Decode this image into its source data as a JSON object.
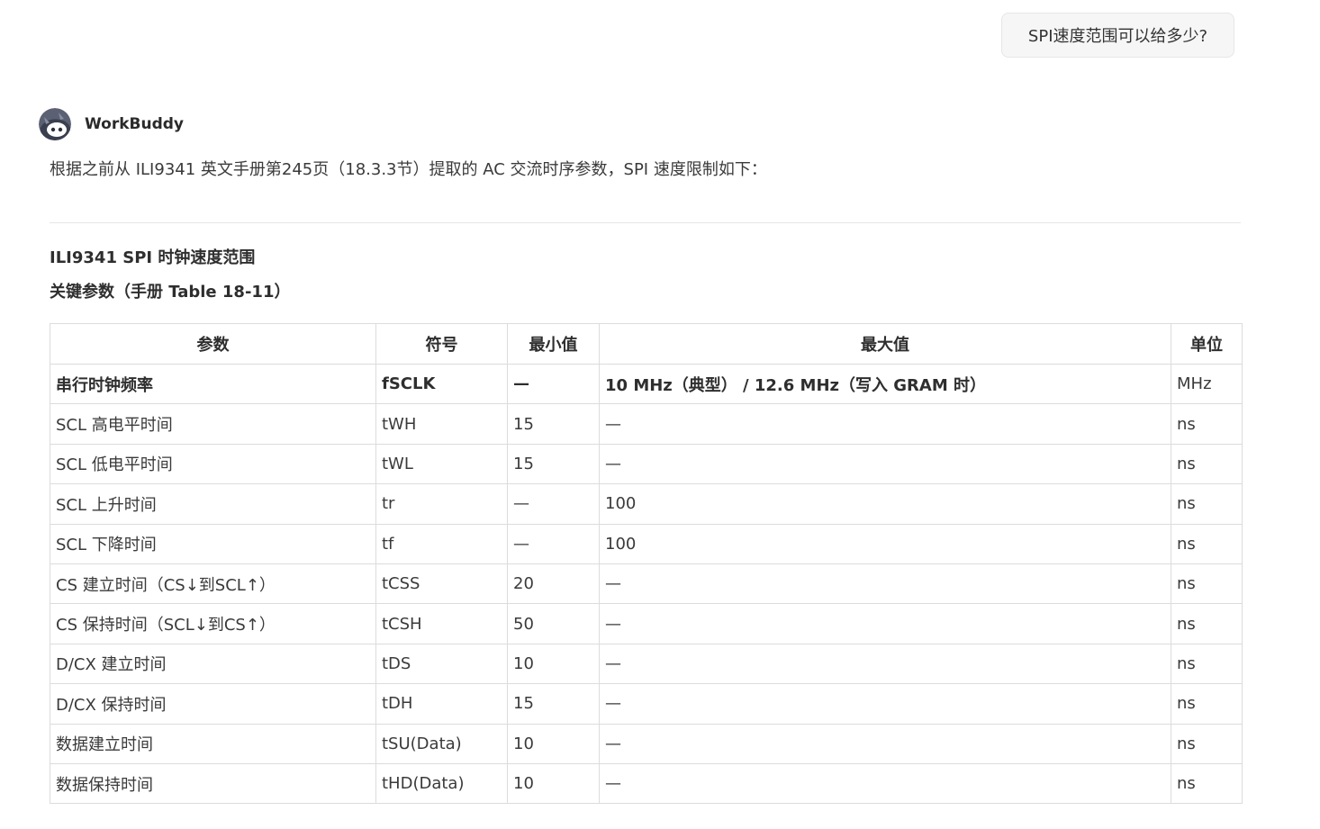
{
  "user_message": {
    "text": "SPI速度范围可以给多少?"
  },
  "assistant": {
    "name": "WorkBuddy",
    "avatar_icon": "robot-avatar-icon",
    "intro": "根据之前从 ILI9341 英文手册第245页（18.3.3节）提取的 AC 交流时序参数，SPI 速度限制如下："
  },
  "section": {
    "title": "ILI9341 SPI 时钟速度范围",
    "subtitle": "关键参数（手册 Table 18-11）"
  },
  "table": {
    "headers": [
      "参数",
      "符号",
      "最小值",
      "最大值",
      "单位"
    ],
    "rows": [
      [
        "串行时钟频率",
        "fSCLK",
        "—",
        "10 MHz（典型） / 12.6 MHz（写入 GRAM 时）",
        "MHz"
      ],
      [
        "SCL 高电平时间",
        "tWH",
        "15",
        "—",
        "ns"
      ],
      [
        "SCL 低电平时间",
        "tWL",
        "15",
        "—",
        "ns"
      ],
      [
        "SCL 上升时间",
        "tr",
        "—",
        "100",
        "ns"
      ],
      [
        "SCL 下降时间",
        "tf",
        "—",
        "100",
        "ns"
      ],
      [
        "CS 建立时间（CS↓到SCL↑）",
        "tCSS",
        "20",
        "—",
        "ns"
      ],
      [
        "CS 保持时间（SCL↓到CS↑）",
        "tCSH",
        "50",
        "—",
        "ns"
      ],
      [
        "D/CX 建立时间",
        "tDS",
        "10",
        "—",
        "ns"
      ],
      [
        "D/CX 保持时间",
        "tDH",
        "15",
        "—",
        "ns"
      ],
      [
        "数据建立时间",
        "tSU(Data)",
        "10",
        "—",
        "ns"
      ],
      [
        "数据保持时间",
        "tHD(Data)",
        "10",
        "—",
        "ns"
      ]
    ]
  }
}
